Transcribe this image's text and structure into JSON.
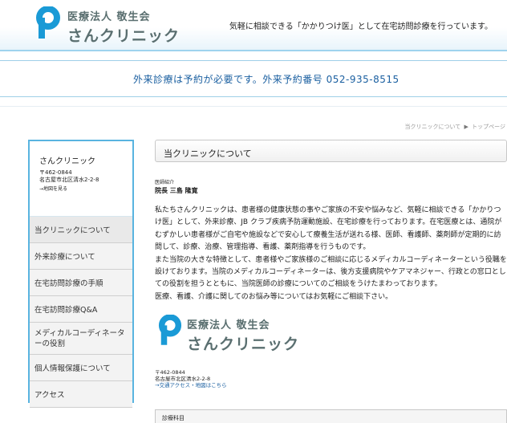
{
  "header": {
    "logo_corp": "医療法人 敬生会",
    "logo_name": "さんクリニック",
    "tagline": "気軽に相談できる「かかりつけ医」として在宅訪問診療を行っています。"
  },
  "banner": {
    "text": "外来診療は予約が必要です。外来予約番号 052-935-8515"
  },
  "breadcrumb": {
    "current": "当クリニックについて",
    "sep": "▶",
    "home": "トップページ"
  },
  "sidebar": {
    "clinic_name": "さんクリニック",
    "postal": "〒462-0844",
    "address": "名古屋市北区清水2-2-8",
    "map_link": "→地図を見る",
    "items": [
      {
        "label": "当クリニックについて"
      },
      {
        "label": "外来診療について"
      },
      {
        "label": "在宅訪問診療の手順"
      },
      {
        "label": "在宅訪問診療Q&A"
      },
      {
        "label": "メディカルコーディネーターの役割"
      },
      {
        "label": "個人情報保護について"
      },
      {
        "label": "アクセス"
      }
    ]
  },
  "content": {
    "title": "当クリニックについて",
    "intro_label": "医師紹介",
    "intro_name": "院長 三島 隆寛",
    "paragraphs": [
      "私たちさんクリニックは、患者様の健康状態の事やご家族の不安や悩みなど、気軽に相談できる「かかりつけ医」として、外来診療、JB クラブ疾病予防運動施設、在宅診療を行っております。在宅医療とは、通院がむずかしい患者様がご自宅や施設などで安心して療養生活が送れる様、医師、看護師、薬剤師が定期的に訪問して、診療、治療、管理指導、看護、薬剤指導を行うものです。",
      "また当院の大きな特徴として、患者様やご家族様のご相談に応じるメディカルコーディネーターという役職を設けております。当院のメディカルコーディネーターは、後方支援病院やケアマネジャー、行政との窓口としての役割を担うとともに、当院医師の診療についてのご相談をうけたまわっております。",
      "医療、看護、介護に関してのお悩み等についてはお気軽にご相談下さい。"
    ],
    "logo_corp": "医療法人 敬生会",
    "logo_name": "さんクリニック",
    "postal": "〒462-0844",
    "address": "名古屋市北区清水2-2-8",
    "access_link": "→交通アクセス・地図はこちら",
    "table_header": "診療科目"
  },
  "colors": {
    "accent": "#59b4e0",
    "brand": "#1a9ad6",
    "banner_text": "#1a5fa0"
  }
}
